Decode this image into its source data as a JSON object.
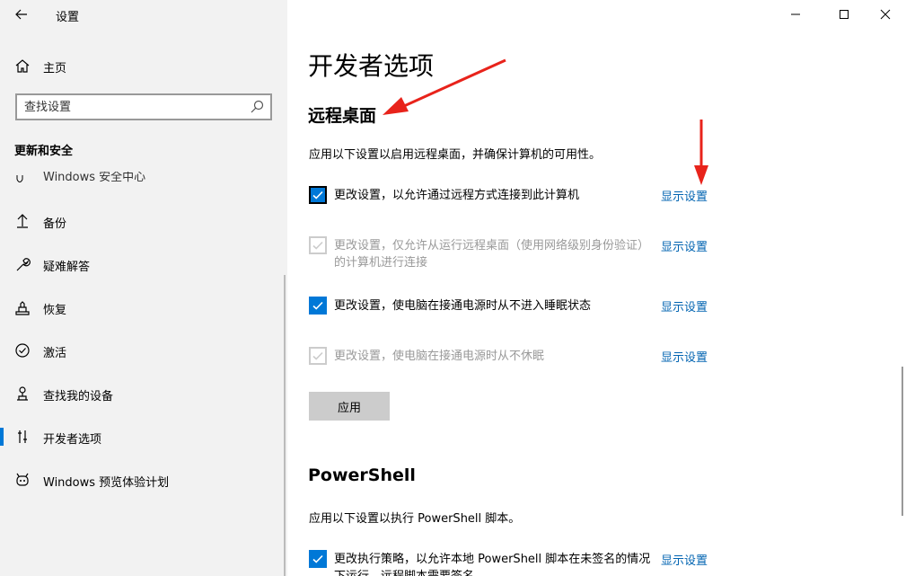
{
  "window": {
    "title": "设置",
    "controls": [
      "minimize",
      "maximize",
      "close"
    ]
  },
  "sidebar": {
    "home_label": "主页",
    "search": {
      "placeholder": "查找设置"
    },
    "section_header": "更新和安全",
    "partial_item_label": "Windows 安全中心",
    "items": [
      {
        "label": "备份",
        "icon": "backup-icon"
      },
      {
        "label": "疑难解答",
        "icon": "wrench-icon"
      },
      {
        "label": "恢复",
        "icon": "recovery-icon"
      },
      {
        "label": "激活",
        "icon": "activation-icon"
      },
      {
        "label": "查找我的设备",
        "icon": "find-device-icon"
      },
      {
        "label": "开发者选项",
        "icon": "developer-icon",
        "active": true
      },
      {
        "label": "Windows 预览体验计划",
        "icon": "insider-icon"
      }
    ]
  },
  "main": {
    "page_title": "开发者选项",
    "remote_desktop": {
      "title": "远程桌面",
      "description": "应用以下设置以启用远程桌面，并确保计算机的可用性。",
      "options": [
        {
          "text": "更改设置，以允许通过远程方式连接到此计算机",
          "state": "checked",
          "enabled": true,
          "link": "显示设置"
        },
        {
          "text": "更改设置，仅允许从运行远程桌面（使用网络级别身份验证）的计算机进行连接",
          "state": "checked",
          "enabled": false,
          "link": "显示设置"
        },
        {
          "text": "更改设置，使电脑在接通电源时从不进入睡眠状态",
          "state": "checked",
          "enabled": true,
          "link": "显示设置"
        },
        {
          "text": "更改设置，使电脑在接通电源时从不休眠",
          "state": "checked",
          "enabled": false,
          "link": "显示设置"
        }
      ],
      "apply_label": "应用"
    },
    "powershell": {
      "title": "PowerShell",
      "description": "应用以下设置以执行 PowerShell 脚本。",
      "options": [
        {
          "text": "更改执行策略，以允许本地 PowerShell 脚本在未签名的情况下运行。远程脚本需要签名。",
          "state": "checked",
          "enabled": true,
          "link": "显示设置"
        }
      ]
    }
  },
  "colors": {
    "accent": "#0078d7",
    "link": "#0063b1",
    "sidebar_bg": "#f2f2f2",
    "annotation_arrow": "#e8231b"
  }
}
